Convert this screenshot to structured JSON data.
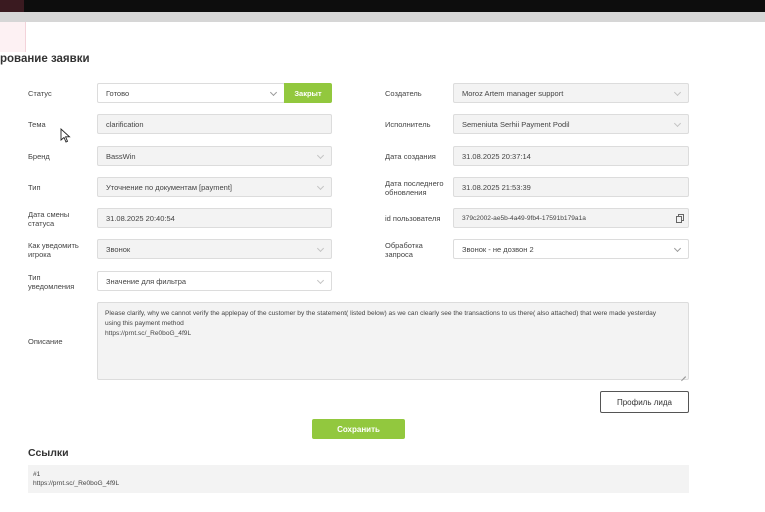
{
  "page_title": "рование заявки",
  "status": {
    "label": "Статус",
    "value": "Готово",
    "closed_button": "Закрыт"
  },
  "topic": {
    "label": "Тема",
    "value": "clarification"
  },
  "brand": {
    "label": "Бренд",
    "value": "BassWin"
  },
  "type": {
    "label": "Тип",
    "value": "Уточнение по документам [payment]"
  },
  "status_change_date": {
    "label_line1": "Дата смены",
    "label_line2": "статуса",
    "value": "31.08.2025 20:40:54"
  },
  "notify_player": {
    "label_line1": "Как уведомить",
    "label_line2": "игрока",
    "value": "Звонок"
  },
  "notify_type": {
    "label_line1": "Тип",
    "label_line2": "уведомления",
    "placeholder": "Значение для фильтра"
  },
  "creator": {
    "label": "Создатель",
    "value": "Moroz Artem manager support"
  },
  "assignee": {
    "label": "Исполнитель",
    "value": "Semeniuta Serhii Payment Podil"
  },
  "created_date": {
    "label": "Дата создания",
    "value": "31.08.2025 20:37:14"
  },
  "updated_date": {
    "label_line1": "Дата последнего",
    "label_line2": "обновления",
    "value": "31.08.2025 21:53:39"
  },
  "user_id": {
    "label": "id пользователя",
    "value": "379c2002-ae5b-4a49-9fb4-17591b179a1a"
  },
  "request_processing": {
    "label_line1": "Обработка",
    "label_line2": "запроса",
    "value": "Звонок - не дозвон 2"
  },
  "description": {
    "label": "Описание",
    "line1": "Please clarify, why we cannot verify the applepay of the customer by the statement( listed below) as we can clearly see the transactions to us there( also attached) that were made yesterday",
    "line2": "using this payment method",
    "line3": "https://prnt.sc/_Re0boG_4f9L"
  },
  "buttons": {
    "profile": "Профиль лида",
    "save": "Сохранить"
  },
  "links": {
    "title": "Ссылки",
    "number": "#1",
    "url": "https://prnt.sc/_Re0boG_4f9L"
  },
  "colors": {
    "accent_green": "#92c83e",
    "field_bg": "#f3f3f3"
  }
}
